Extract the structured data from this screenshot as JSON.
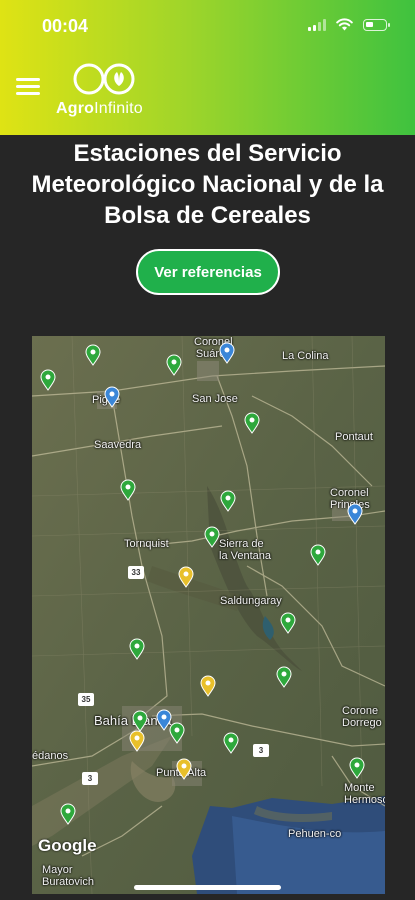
{
  "status_bar": {
    "time": "00:04"
  },
  "header": {
    "logo_name_bold": "Agro",
    "logo_name_light": "Infinito"
  },
  "page": {
    "title_line1": "Estaciones del Servicio",
    "title_line2": "Meteorológico Nacional y de la",
    "title_line3": "Bolsa de Cereales",
    "button_label": "Ver referencias"
  },
  "map": {
    "labels": {
      "coronel_suarez": "Coronel\nSuárez",
      "la_colina": "La Colina",
      "pigue": "Pigüé",
      "san_jose": "San Jose",
      "pontaut": "Pontaut",
      "saavedra": "Saavedra",
      "coronel_pringles": "Coronel\nPringles",
      "tornquist": "Tornquist",
      "sierra_ventana": "Sierra de\nla Ventana",
      "saldungaray": "Saldungaray",
      "coronel_dorrego": "Corone\nDorrego",
      "bahia_blanca": "Bahía Blanca",
      "medanos": "édanos",
      "punta_alta": "Punta Alta",
      "monte_hermoso": "Monte\nHermoso",
      "pehuen_co": "Pehuen-co",
      "mayor_buratovich": "Mayor\nBuratovich"
    },
    "shields": [
      "33",
      "35",
      "3",
      "3"
    ],
    "google_label": "Google",
    "pin_colors": {
      "green": "#2ea83c",
      "blue": "#3a86d8",
      "yellow": "#e8c02b"
    }
  }
}
